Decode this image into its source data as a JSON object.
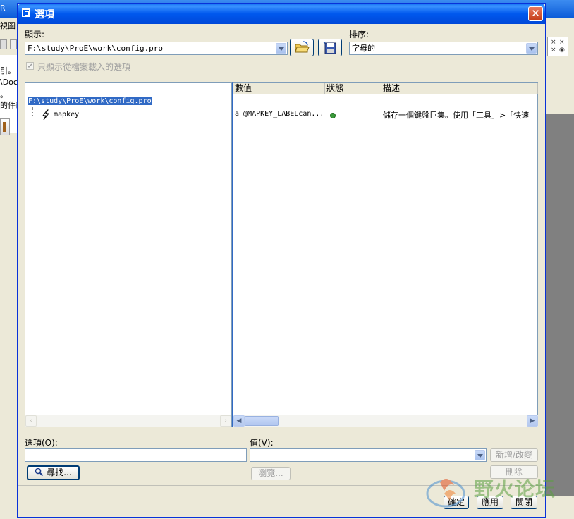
{
  "background_app": {
    "title_fragment": "R",
    "menu_fragment": "視圖",
    "left_texts": [
      "引。",
      "\\Doc",
      "。",
      "的件已"
    ]
  },
  "dialog": {
    "title": "選項",
    "close_label": "✕",
    "show_label": "顯示:",
    "show_value": "F:\\study\\ProE\\work\\config.pro",
    "sort_label": "排序:",
    "sort_value": "字母的",
    "only_loaded_checkbox": "只顯示從檔案載入的選項",
    "tree": {
      "root": "F:\\study\\ProE\\work\\config.pro",
      "child": "mapkey"
    },
    "table": {
      "headers": [
        "數值",
        "狀態",
        "描述"
      ],
      "rows": [
        {
          "value": "a @MAPKEY_LABELcan...",
          "status": "active",
          "description": "儲存一個鍵盤巨集。使用「工具」>「快速"
        }
      ]
    },
    "option_label": "選項(O):",
    "option_value": "",
    "value_label": "值(V):",
    "value_value": "",
    "add_change_button": "新增/改變",
    "find_button": "尋找...",
    "browse_button": "瀏覽...",
    "delete_button": "刪除",
    "ok_button": "確定",
    "apply_button": "應用",
    "close_button": "關閉"
  },
  "watermark": {
    "text": "野火论坛"
  },
  "colors": {
    "titlebar": "#0058ee",
    "dialog_bg": "#ece9d8",
    "status_dot": "#3a9a3a",
    "selection": "#316ac5"
  }
}
